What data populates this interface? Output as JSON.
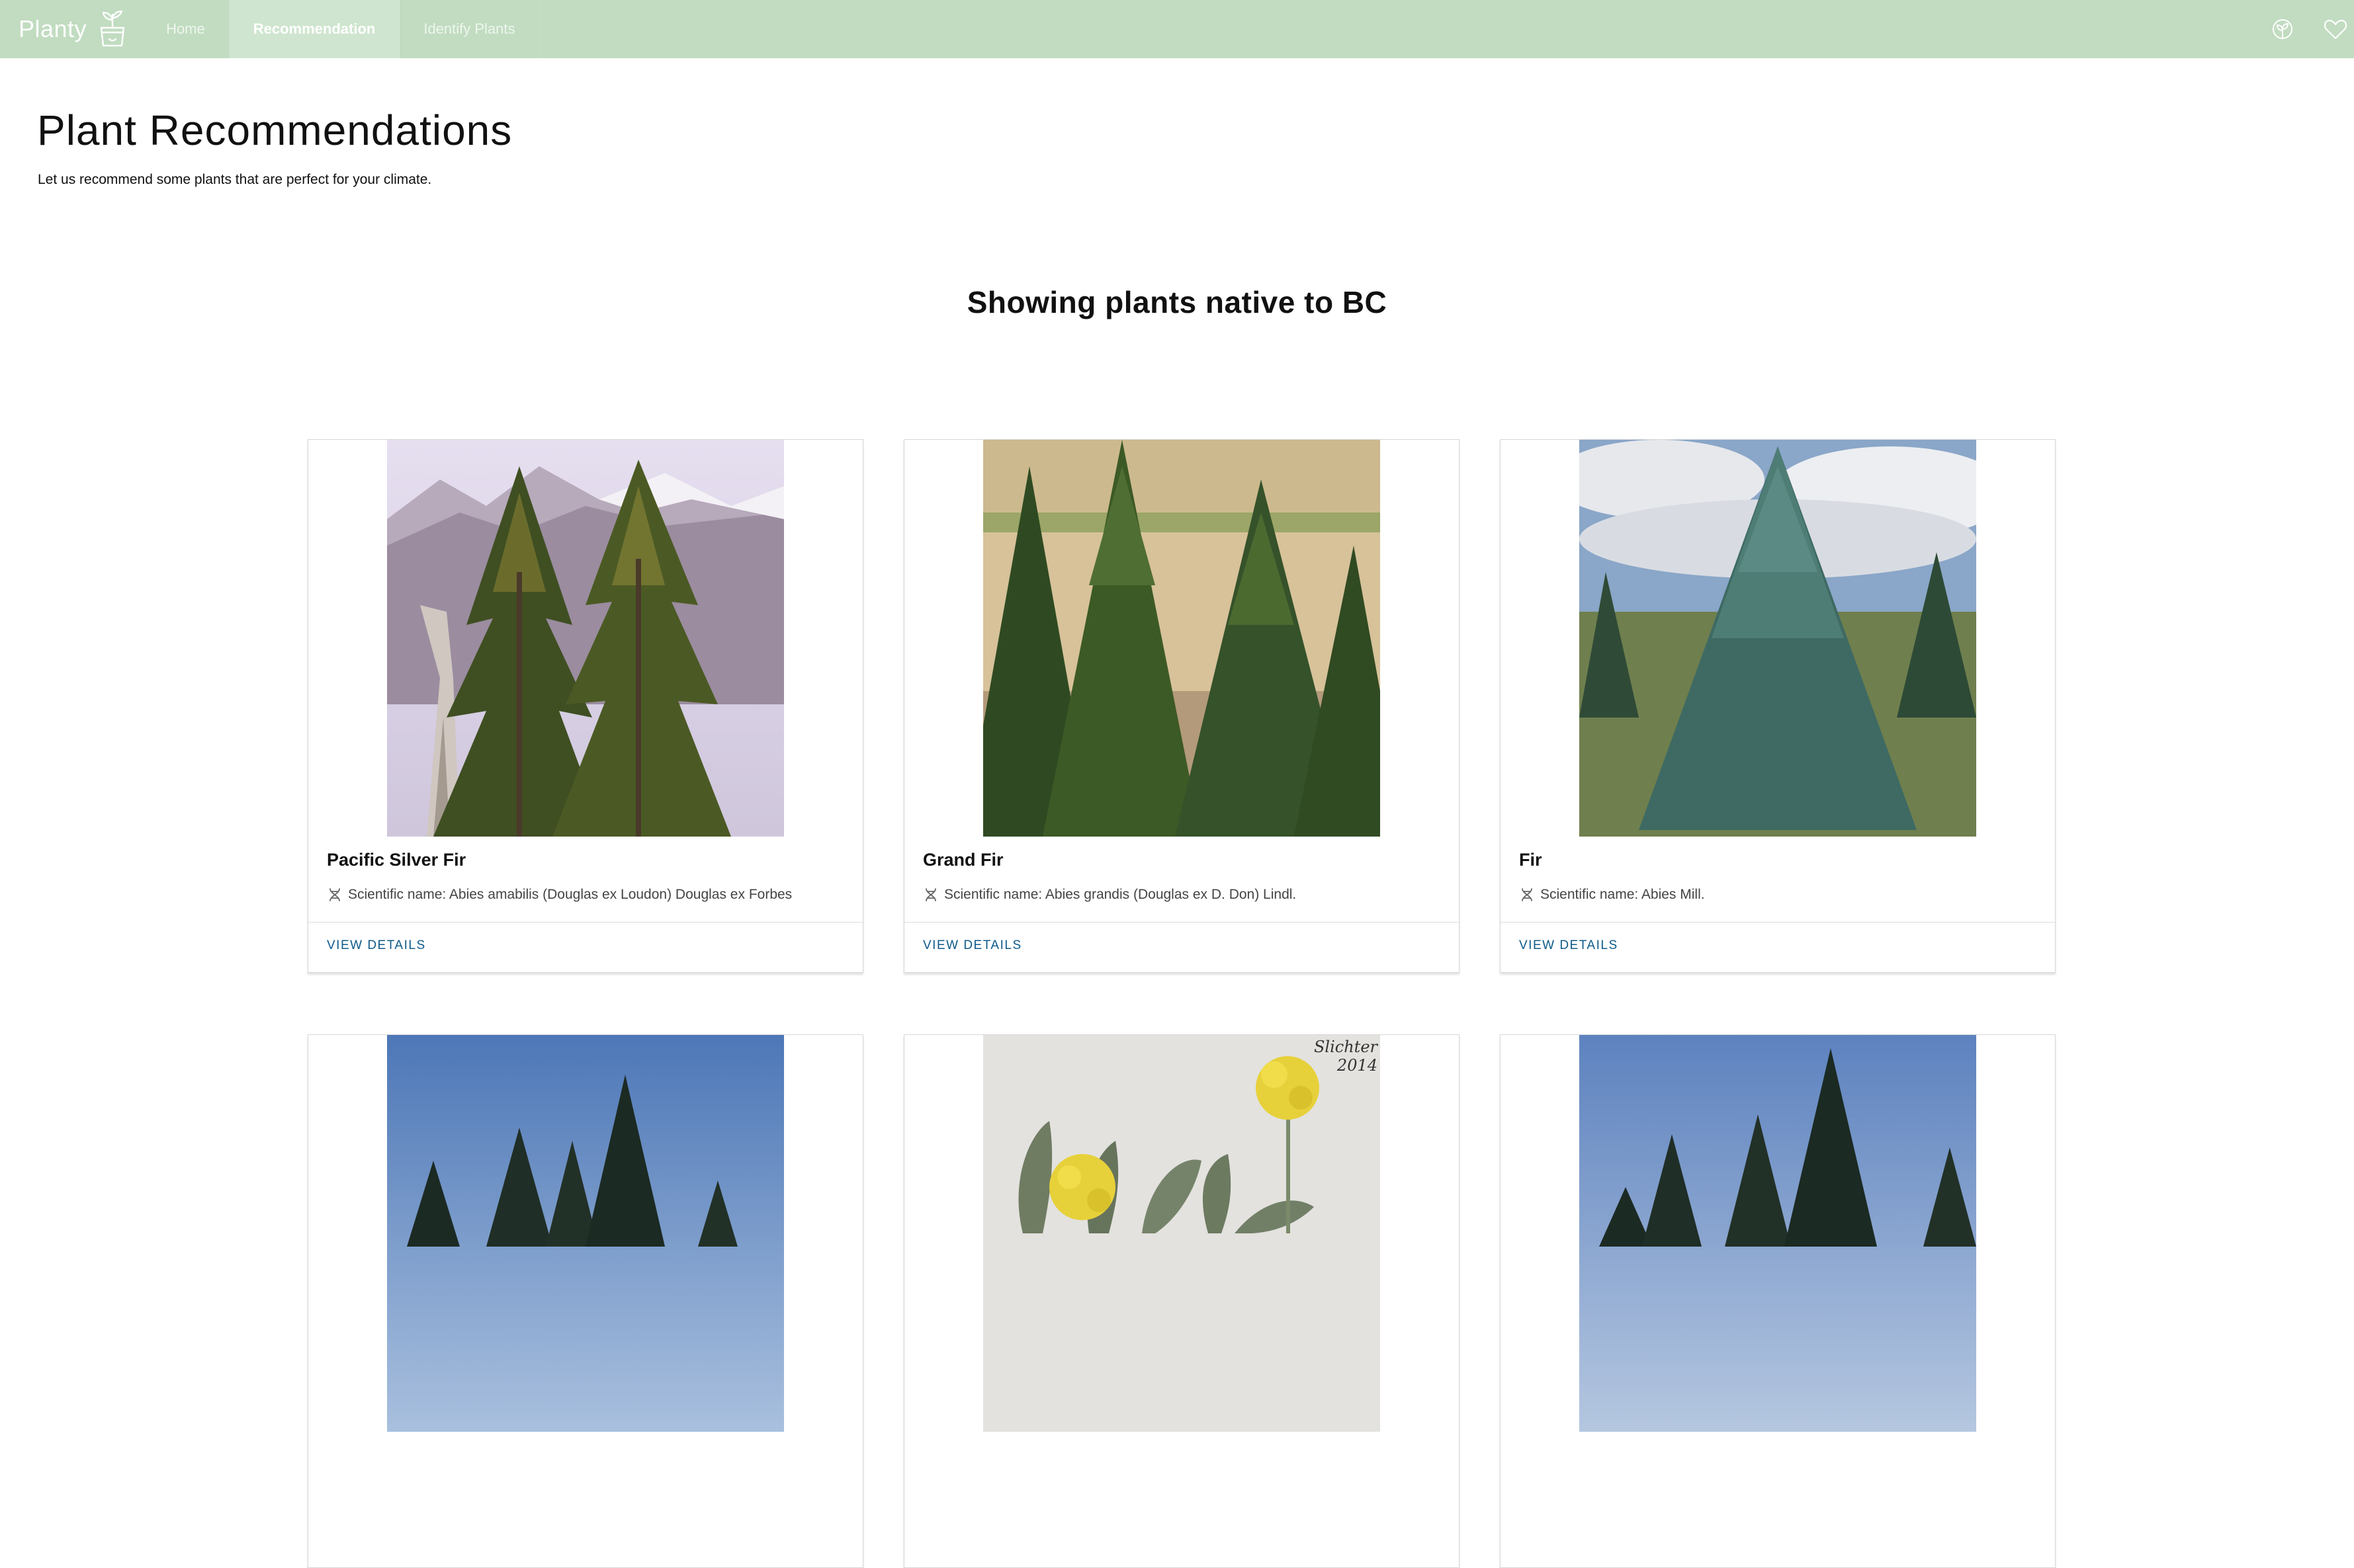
{
  "brand": {
    "name": "Planty",
    "icon": "potted-sprout-icon"
  },
  "nav": {
    "items": [
      {
        "label": "Home",
        "active": false
      },
      {
        "label": "Recommendation",
        "active": true
      },
      {
        "label": "Identify Plants",
        "active": false
      }
    ]
  },
  "top_icons": [
    "seedling-icon",
    "heart-icon"
  ],
  "header": {
    "title": "Plant Recommendations",
    "subtitle": "Let us recommend some plants that are perfect for your climate."
  },
  "section": {
    "title": "Showing plants native to BC"
  },
  "cards": [
    {
      "name": "Pacific Silver Fir",
      "scientific": "Scientific name: Abies amabilis (Douglas ex Loudon) Douglas ex Forbes",
      "action": "VIEW DETAILS"
    },
    {
      "name": "Grand Fir",
      "scientific": "Scientific name: Abies grandis (Douglas ex D. Don) Lindl.",
      "action": "VIEW DETAILS"
    },
    {
      "name": "Fir",
      "scientific": "Scientific name: Abies Mill.",
      "action": "VIEW DETAILS"
    },
    {
      "name": "",
      "scientific": "",
      "action": ""
    },
    {
      "name": "",
      "scientific": "",
      "action": ""
    },
    {
      "name": "",
      "scientific": "",
      "action": ""
    }
  ],
  "photo_watermark": "Slichter\n2014",
  "colors": {
    "topbar": "#c1dcc0",
    "link": "#0d5a8a"
  }
}
